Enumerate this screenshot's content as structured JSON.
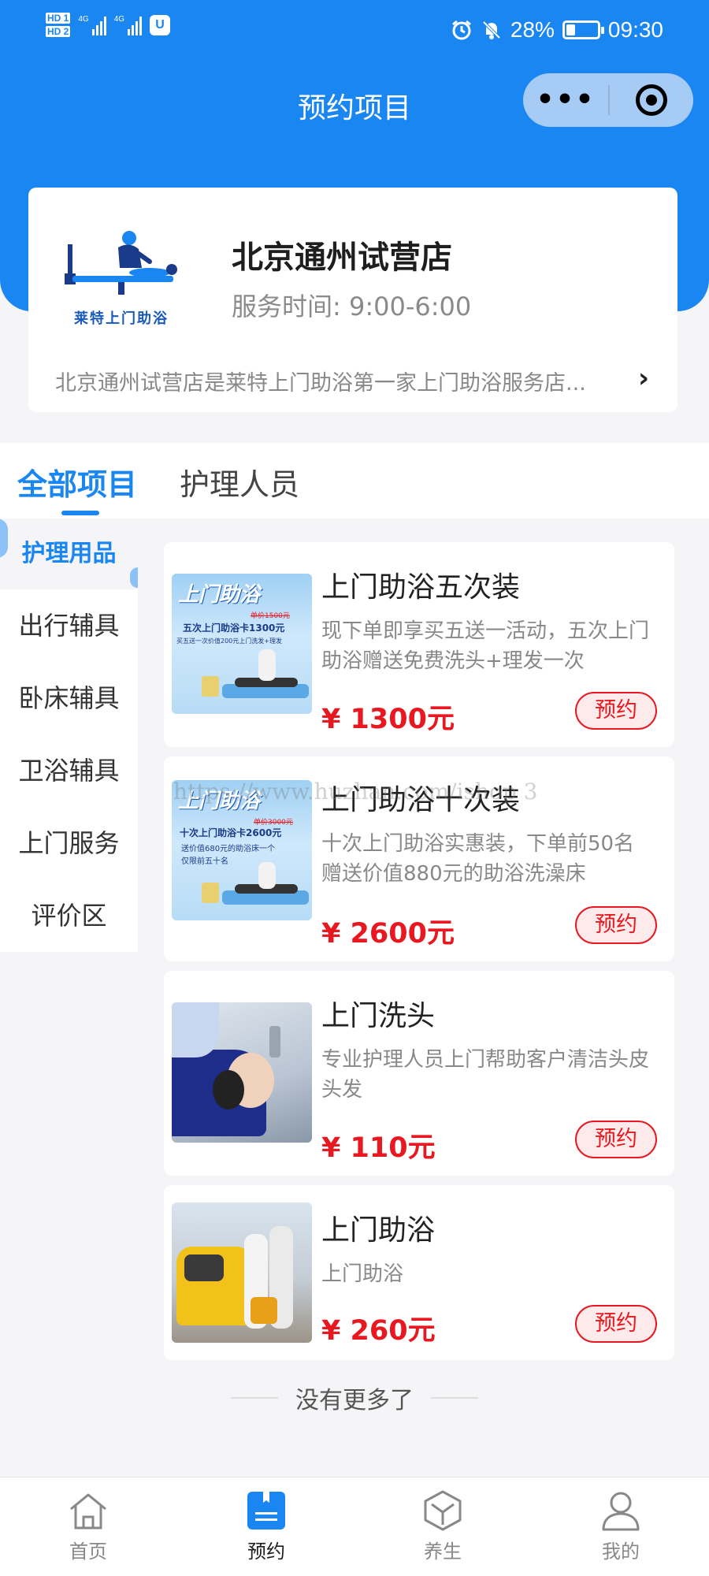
{
  "status_bar": {
    "hd1": "HD 1",
    "hd2": "HD 2",
    "net1": "4G",
    "net2": "4G",
    "battery_text": "28%",
    "battery_level": 0.28,
    "time": "09:30"
  },
  "nav": {
    "title": "预约项目",
    "more_icon": "more-dots-icon",
    "close_icon": "target-icon"
  },
  "store": {
    "logo_text": "莱特上门助浴",
    "name": "北京通州试营店",
    "hours": "服务时间: 9:00-6:00",
    "description": "北京通州试营店是莱特上门助浴第一家上门助浴服务店..."
  },
  "tabs": [
    {
      "label": "全部项目",
      "active": true
    },
    {
      "label": "护理人员",
      "active": false
    }
  ],
  "categories": [
    "护理用品",
    "出行辅具",
    "卧床辅具",
    "卫浴辅具",
    "上门服务",
    "评价区"
  ],
  "products": [
    {
      "title": "上门助浴五次装",
      "desc": "现下单即享买五送一活动，五次上门助浴赠送免费洗头+理发一次",
      "price": "¥ 1300元",
      "button": "预约",
      "img": {
        "banner": "上门助浴",
        "old_price": "单价1500元",
        "line1": "五次上门助浴卡1300元",
        "line2": "买五送一次价值200元上门洗发+理发",
        "line3": ""
      }
    },
    {
      "title": "上门助浴十次装",
      "desc": "十次上门助浴实惠装，下单前50名赠送价值880元的助浴洗澡床",
      "price": "¥ 2600元",
      "button": "预约",
      "img": {
        "banner": "上门助浴",
        "old_price": "单价3000元",
        "line1": "十次上门助浴卡2600元",
        "line2": "送价值680元的助浴床一个",
        "line3": "仅限前五十名"
      }
    },
    {
      "title": "上门洗头",
      "desc": "专业护理人员上门帮助客户清洁头皮头发",
      "price": "¥ 110元",
      "button": "预约"
    },
    {
      "title": "上门助浴",
      "desc": "上门助浴",
      "price": "¥ 260元",
      "button": "预约"
    }
  ],
  "footer_note": "没有更多了",
  "watermark": "https://www.huzhan.com/ishop 3",
  "tabbar": [
    {
      "label": "首页",
      "icon": "home-icon",
      "active": false
    },
    {
      "label": "预约",
      "icon": "booking-icon",
      "active": true
    },
    {
      "label": "养生",
      "icon": "cube-icon",
      "active": false
    },
    {
      "label": "我的",
      "icon": "user-icon",
      "active": false
    }
  ],
  "colors": {
    "primary": "#1a86f2",
    "price": "#e81820",
    "background": "#f5f5f7"
  }
}
